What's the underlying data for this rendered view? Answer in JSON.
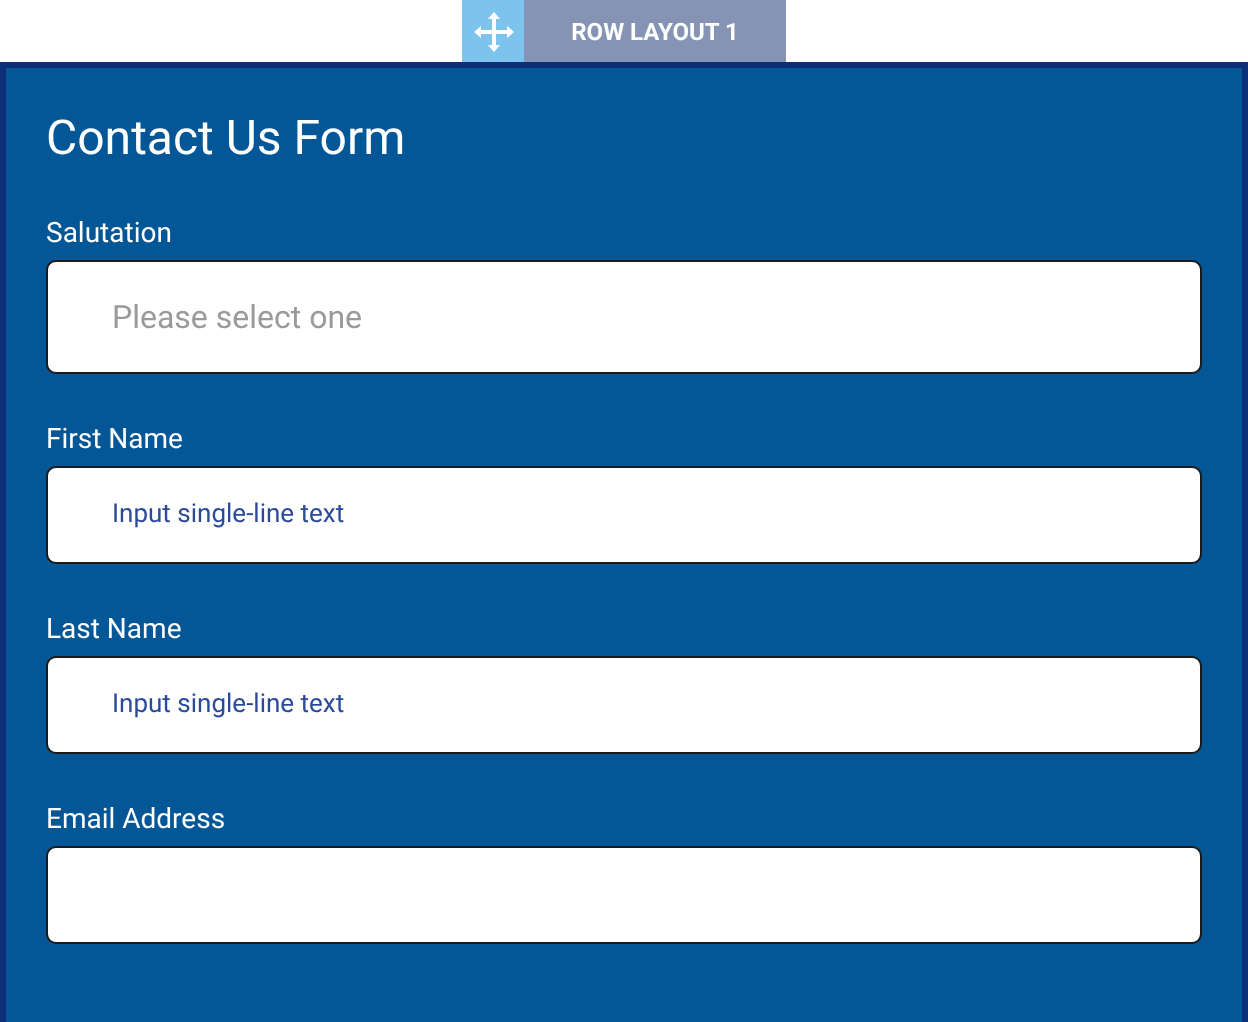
{
  "toolbar": {
    "label": "ROW LAYOUT 1"
  },
  "form": {
    "title": "Contact Us Form",
    "fields": [
      {
        "kind": "select",
        "label": "Salutation",
        "placeholder": "Please select one"
      },
      {
        "kind": "text",
        "label": "First Name",
        "placeholder": "Input single-line text"
      },
      {
        "kind": "text",
        "label": "Last Name",
        "placeholder": "Input single-line text"
      },
      {
        "kind": "text",
        "label": "Email Address"
      }
    ]
  }
}
